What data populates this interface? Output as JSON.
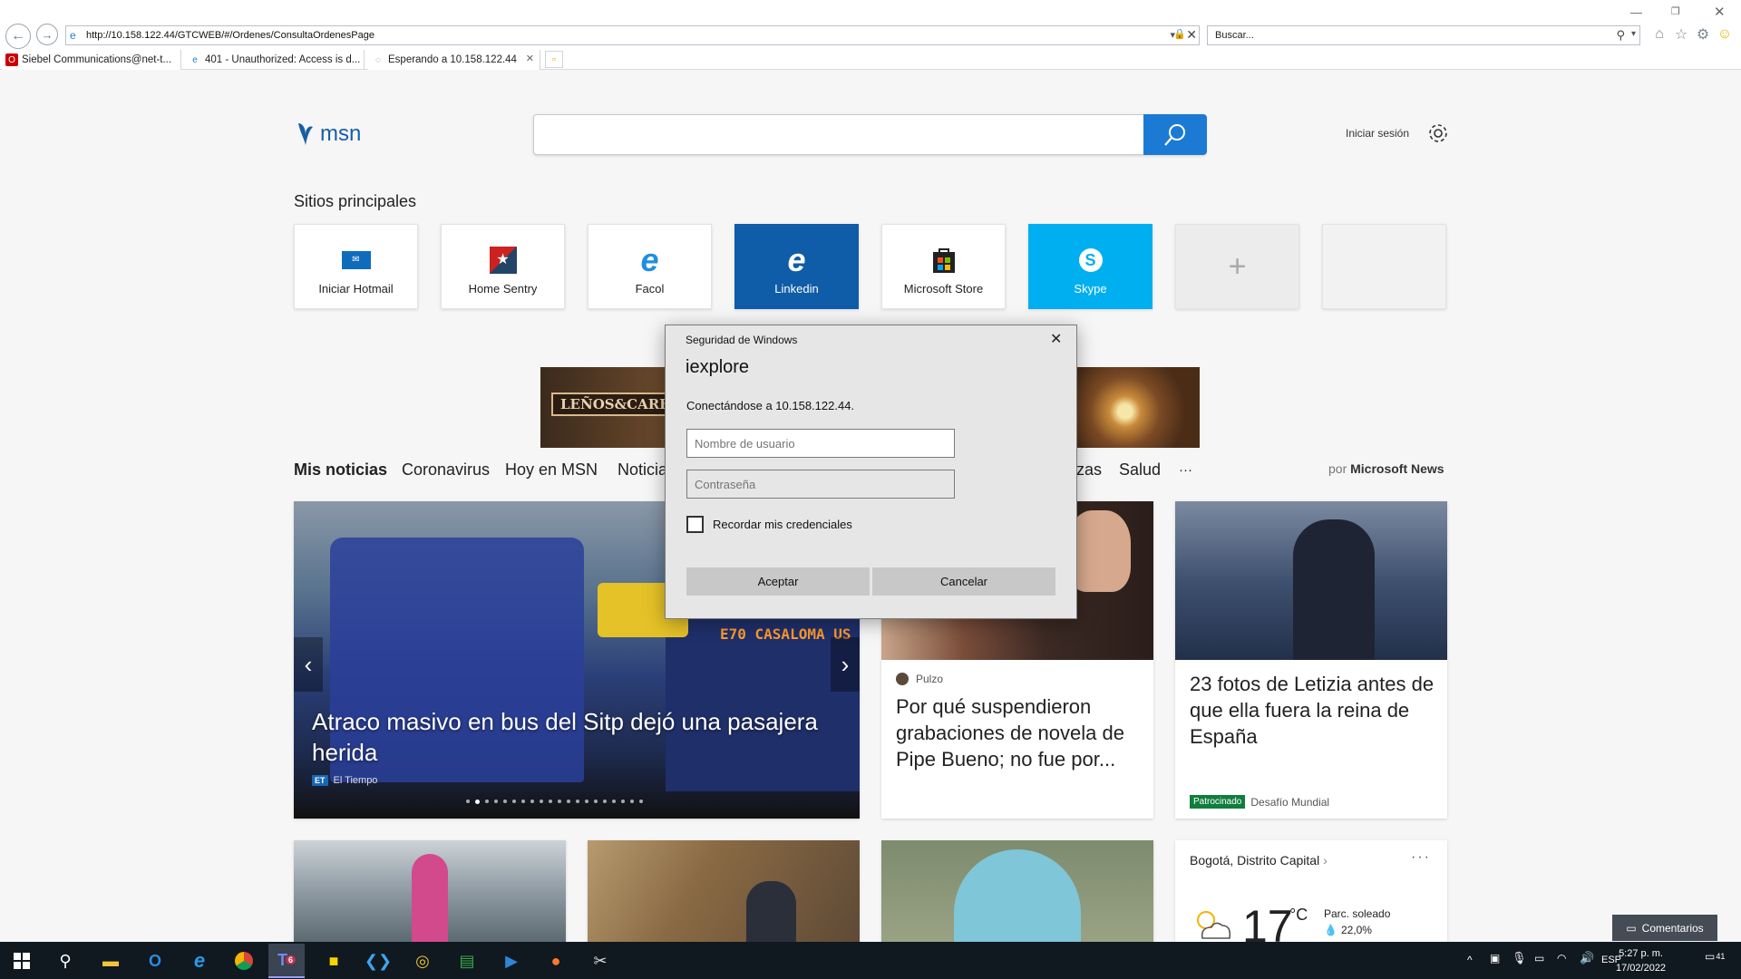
{
  "browser": {
    "address": "http://10.158.122.44/GTCWEB/#/Ordenes/ConsultaOrdenesPage",
    "search_placeholder": "Buscar...",
    "tabs": [
      {
        "label": "Siebel Communications@net-t..."
      },
      {
        "label": "401 - Unauthorized: Access is d..."
      },
      {
        "label": "Esperando a 10.158.122.44"
      }
    ]
  },
  "msn": {
    "logo_text": "msn",
    "signin": "Iniciar sesión",
    "top_sites_title": "Sitios principales",
    "sites": [
      {
        "label": "Iniciar Hotmail"
      },
      {
        "label": "Home Sentry"
      },
      {
        "label": "Facol"
      },
      {
        "label": "Linkedin"
      },
      {
        "label": "Microsoft Store"
      },
      {
        "label": "Skype"
      }
    ],
    "ad_text": "LEÑOS&CARBÓN",
    "news_tabs": [
      "Mis noticias",
      "Coronavirus",
      "Hoy en MSN",
      "Noticia",
      "zas",
      "Salud",
      "···"
    ],
    "by_prefix": "por",
    "by_source": "Microsoft News",
    "hero": {
      "title": "Atraco masivo en bus del Sitp dejó una pasajera herida",
      "source_badge": "ET",
      "source": "El Tiempo",
      "bus_sign": "E70 CASALOMA US"
    },
    "card2": {
      "source": "Pulzo",
      "title": "Por qué suspendieron grabaciones de novela de Pipe Bueno; no fue por..."
    },
    "card3": {
      "title": "23 fotos de Letizia antes de que ella fuera la reina de España",
      "badge": "Patrocinado",
      "source": "Desafío Mundial"
    },
    "weather": {
      "location": "Bogotá, Distrito Capital",
      "temp": "17",
      "unit": "°C",
      "desc": "Parc. soleado",
      "rain": "22,0%"
    },
    "feedback": "Comentarios"
  },
  "dialog": {
    "title": "Seguridad de Windows",
    "app": "iexplore",
    "message": "Conectándose a 10.158.122.44.",
    "user_placeholder": "Nombre de usuario",
    "pass_placeholder": "Contraseña",
    "remember": "Recordar mis credenciales",
    "ok": "Aceptar",
    "cancel": "Cancelar"
  },
  "taskbar": {
    "lang": "ESP",
    "time": "5:27 p. m.",
    "date": "17/02/2022",
    "notifications": "41",
    "teams_badge": "6"
  }
}
